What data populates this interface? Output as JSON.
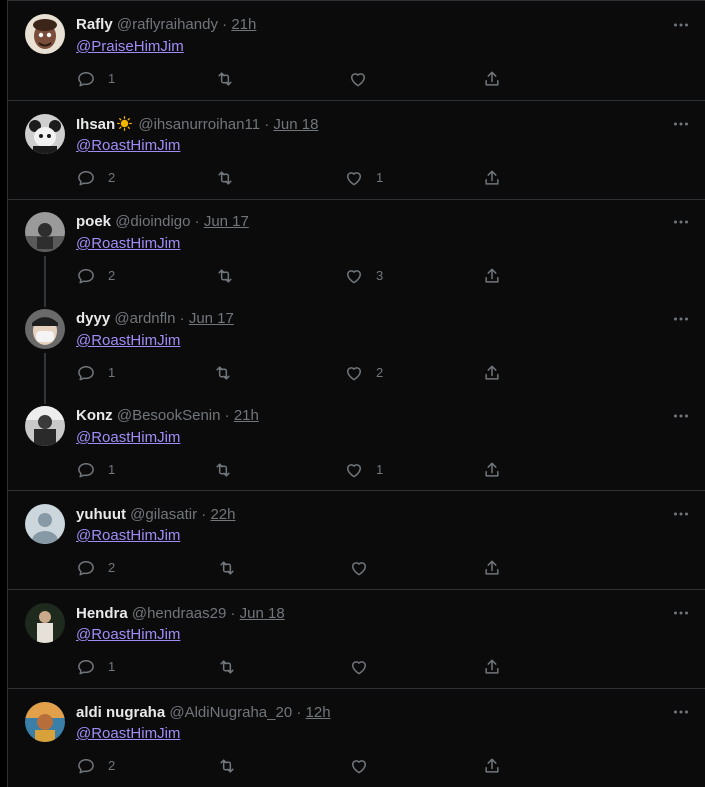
{
  "tweets": [
    {
      "name": "Rafly",
      "handle": "@raflyraihandy",
      "time": "21h",
      "mention": "@PraiseHimJim",
      "replies": "1",
      "retweets": "",
      "likes": "",
      "avatar_color": "#7a4e3a"
    },
    {
      "name": "Ihsan",
      "handle": "@ihsanurroihan11",
      "time": "Jun 18",
      "mention": "@RoastHimJim",
      "replies": "2",
      "retweets": "",
      "likes": "1",
      "avatar_color": "#cfcfcf",
      "name_emoji": "sun-emoji"
    },
    {
      "name": "poek",
      "handle": "@dioindigo",
      "time": "Jun 17",
      "mention": "@RoastHimJim",
      "replies": "2",
      "retweets": "",
      "likes": "3",
      "avatar_color": "#8a8a8a"
    },
    {
      "name": "dyyy",
      "handle": "@ardnfln",
      "time": "Jun 17",
      "mention": "@RoastHimJim",
      "replies": "1",
      "retweets": "",
      "likes": "2",
      "avatar_color": "#d9d9d9"
    },
    {
      "name": "Konz",
      "handle": "@BesookSenin",
      "time": "21h",
      "mention": "@RoastHimJim",
      "replies": "1",
      "retweets": "",
      "likes": "1",
      "avatar_color": "#4a4a4a"
    },
    {
      "name": "yuhuut",
      "handle": "@gilasatir",
      "time": "22h",
      "mention": "@RoastHimJim",
      "replies": "2",
      "retweets": "",
      "likes": "",
      "avatar_color": "#ccd6dd"
    },
    {
      "name": "Hendra",
      "handle": "@hendraas29",
      "time": "Jun 18",
      "mention": "@RoastHimJim",
      "replies": "1",
      "retweets": "",
      "likes": "",
      "avatar_color": "#2c3a2c"
    },
    {
      "name": "aldi nugraha",
      "handle": "@AldiNugraha_20",
      "time": "12h",
      "mention": "@RoastHimJim",
      "replies": "2",
      "retweets": "",
      "likes": "",
      "avatar_color": "#c07a3a"
    }
  ],
  "separator": "·",
  "colors": {
    "background": "#000000",
    "panel": "#0b0b0c",
    "border": "#2f3336",
    "text": "#e7e9ea",
    "muted": "#71767b",
    "mention": "#a18cf7"
  },
  "icons": [
    "reply-icon",
    "retweet-icon",
    "like-icon",
    "share-icon",
    "more-icon"
  ]
}
